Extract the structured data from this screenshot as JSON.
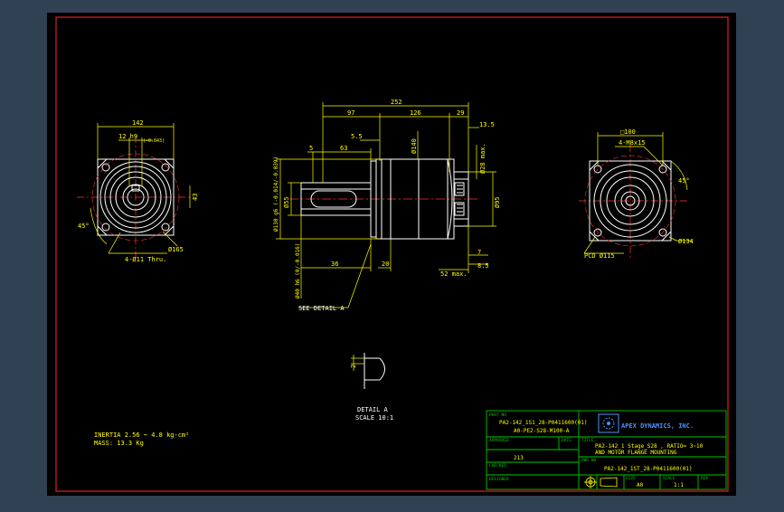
{
  "colors": {
    "background": "#2f4152",
    "sheet": "#000000",
    "border": "#e02020",
    "line": "#ffffff",
    "dimension": "#ffff00",
    "centerline": "#ff3030",
    "titleblock": "#00c800",
    "titletext": "#ffff00",
    "logo": "#4f8fff"
  },
  "views": {
    "front": {
      "dim_width": "142",
      "dim_keyway": "12 h9",
      "dim_keyway_tol": "(-0.043)",
      "dim_side": "43",
      "dim_angle": "45°",
      "dim_pcd": "Ø165",
      "dim_holes": "4-Ø11 Thru."
    },
    "side": {
      "dim_total": "252",
      "dim_97": "97",
      "dim_126": "126",
      "dim_29": "29",
      "dim_13_5": "13.5",
      "dim_5_5": "5.5",
      "dim_5": "5",
      "dim_63": "63",
      "dim_140": "Ø140",
      "dim_28max": "Ø28 max.",
      "dim_130": "Ø130 g6 (-0.014/-0.039)",
      "dim_55": "Ø55",
      "dim_95": "Ø95",
      "dim_40": "Ø40 h6 (0/-0.016)",
      "dim_36": "36",
      "dim_20": "20",
      "dim_52max": "52 max.",
      "dim_7": "7",
      "dim_8_5": "8.5",
      "see_detail": "SEE DETAIL A"
    },
    "rear": {
      "dim_square": "□100",
      "dim_holes": "4-M8x15",
      "dim_angle": "45°",
      "dim_134": "Ø134",
      "dim_pcd": "PCD Ø115"
    },
    "detail": {
      "dim_2": "2",
      "label": "DETAIL A",
      "scale": "SCALE 10:1"
    }
  },
  "notes": {
    "inertia": "INERTIA 2.56 ~ 4.8 kg-cm²",
    "mass": "MASS: 13.3 Kg"
  },
  "titleblock": {
    "part_no_label": "PART NO",
    "part_no_line1": "PA2-142_1S1_28-P0411600(01)",
    "part_no_line2": "A0-PE2-S28-M100-A",
    "company": "APEX DYNAMICS, INC.",
    "approved_label": "APPROVED",
    "date_label": "DATE",
    "checked_label": "CHECKED",
    "checked_value": "213",
    "designer_label": "DESIGNER",
    "title_label": "TITLE",
    "title_line1": "PA2-142_1 Stage_S28 , RATIO= 3~10",
    "title_line2": "AND MOTOR FLANGE MOUNTING",
    "dwg_label": "DWG NO",
    "dwg_value": "PA2-142_1ST_28-P0411600(01)",
    "size_label": "SIZE",
    "size_value": "A0",
    "scale_label": "SCALE",
    "scale_value": "1:1",
    "rev_label": "REV"
  }
}
